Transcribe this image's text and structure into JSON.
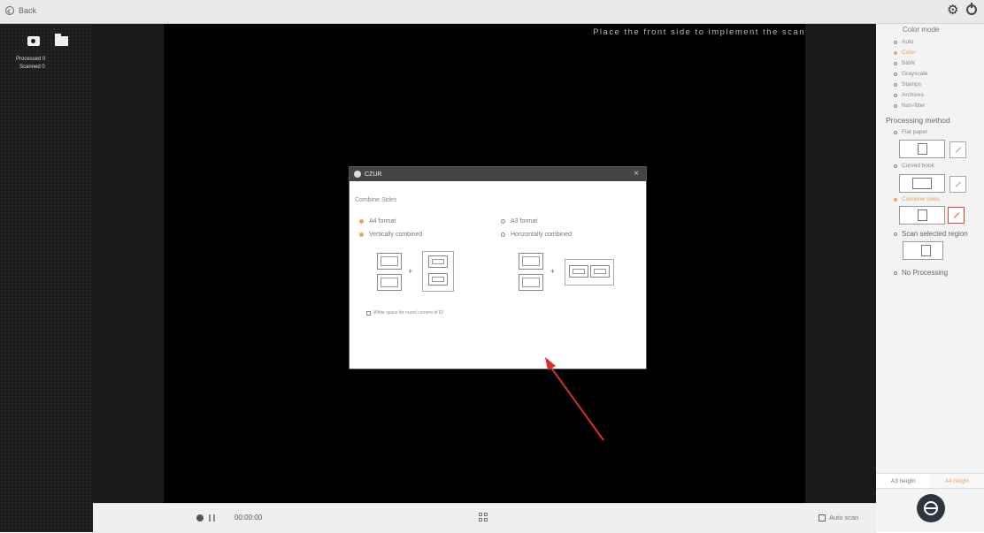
{
  "topbar": {
    "back_label": "Back"
  },
  "left": {
    "processed_label": "Processed",
    "processed_count": "0",
    "scanned_label": "Scanned",
    "scanned_count": "0"
  },
  "viewer": {
    "hint": "Place the front side to implement the scan"
  },
  "dialog": {
    "title": "CZUR",
    "heading": "Combine Sides",
    "left_format": "A4 format",
    "left_combine": "Vertically combined",
    "right_format": "A3 format",
    "right_combine": "Horizontally combined",
    "checkbox_label": "White space for round corners of ID"
  },
  "right": {
    "color_mode_title": "Color mode",
    "color_modes": [
      "Auto",
      "Color",
      "B&W",
      "Grayscale",
      "Stamps",
      "Archives",
      "Non-filter"
    ],
    "color_mode_selected": "Color",
    "processing_title": "Processing method",
    "flat_paper": "Flat paper",
    "curved_book": "Curved book",
    "combine_sides": "Combine sides",
    "scan_region": "Scan selected region",
    "no_processing": "No Processing",
    "tab_a3": "A3 height",
    "tab_a4": "A4 height"
  },
  "bottom": {
    "timer": "00:00:00",
    "auto_scan": "Auto scan"
  },
  "colors": {
    "accent": "#f2a257",
    "highlight_red": "#e04040",
    "canvas": "#000000"
  }
}
